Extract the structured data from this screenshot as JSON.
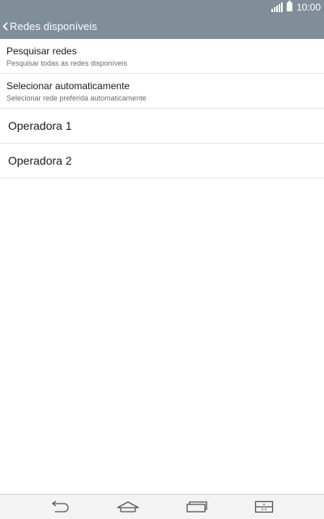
{
  "status_bar": {
    "time": "10:00",
    "icons": [
      "signal-icon",
      "battery-icon"
    ]
  },
  "action_bar": {
    "back_icon": "chevron-left-icon",
    "title": "Redes disponíveis"
  },
  "list": {
    "items": [
      {
        "title": "Pesquisar redes",
        "subtitle": "Pesquisar todas as redes disponíveis"
      },
      {
        "title": "Selecionar automaticamente",
        "subtitle": "Selecionar rede preferida automaticamente"
      },
      {
        "title": "Operadora 1"
      },
      {
        "title": "Operadora 2"
      }
    ]
  },
  "nav_bar": {
    "icons": [
      "back-icon",
      "home-icon",
      "recent-apps-icon",
      "dual-window-icon"
    ]
  },
  "colors": {
    "header_bg": "#7f8e98",
    "divider": "#e4e4e4",
    "nav_bg": "#f3f3f3"
  }
}
